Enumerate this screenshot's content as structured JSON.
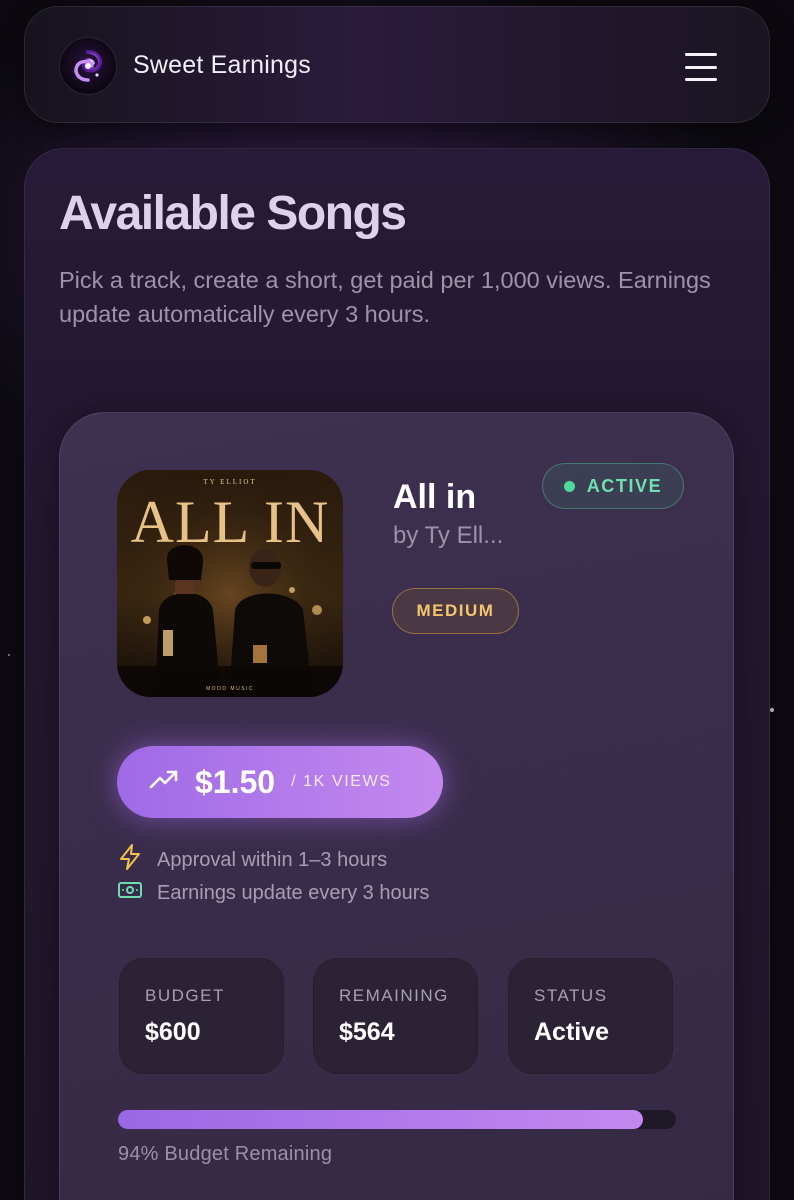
{
  "header": {
    "brand": "Sweet Earnings",
    "logo_icon": "swirl-logo-icon",
    "menu_icon": "hamburger-menu-icon"
  },
  "intro": {
    "title": "Available Songs",
    "subtitle": "Pick a track, create a short, get paid per 1,000 views. Earnings update automatically every 3 hours."
  },
  "song": {
    "cover": {
      "artist_text": "TY ELLIOT",
      "title_text": "ALL IN",
      "label_text": "MOOD MUSIC"
    },
    "title": "All in",
    "artist": "by Ty Ell...",
    "status_badge": "ACTIVE",
    "difficulty": "MEDIUM",
    "rate_value": "$1.50",
    "rate_unit": "/ 1K VIEWS",
    "rate_icon": "trending-up-icon",
    "info": [
      {
        "icon": "lightning-icon",
        "text": "Approval within 1–3 hours"
      },
      {
        "icon": "cash-icon",
        "text": "Earnings update every 3 hours"
      }
    ],
    "stats": [
      {
        "label": "BUDGET",
        "value": "$600"
      },
      {
        "label": "REMAINING",
        "value": "$564"
      },
      {
        "label": "STATUS",
        "value": "Active"
      }
    ],
    "budget_remaining_fraction": 0.94,
    "progress_label": "94% Budget Remaining"
  },
  "colors": {
    "accent_purple": "#b07be9",
    "active_green": "#4fd99c",
    "medium_gold": "#f3c56e"
  }
}
